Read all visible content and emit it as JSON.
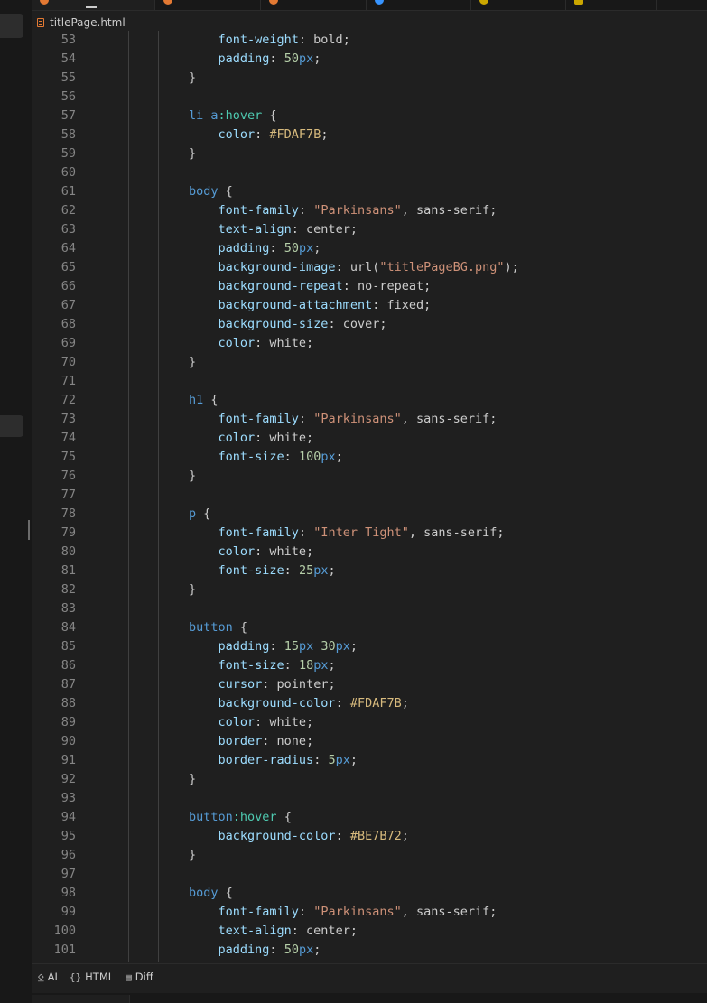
{
  "tab_icon_colors": [
    "#e37933",
    "#e37933",
    "#e37933",
    "#3794ff",
    "#cca700"
  ],
  "breadcrumb": {
    "file_name": "titlePage.html",
    "icon": "html-file-icon"
  },
  "code_lines": [
    {
      "n": "53",
      "t": [
        [
          "    ",
          "punc"
        ],
        [
          "font-weight",
          "prop"
        ],
        [
          ": bold;",
          "punc"
        ]
      ]
    },
    {
      "n": "54",
      "t": [
        [
          "    ",
          "punc"
        ],
        [
          "padding",
          "prop"
        ],
        [
          ": ",
          "punc"
        ],
        [
          "50",
          "num"
        ],
        [
          "px",
          "unit"
        ],
        [
          ";",
          "punc"
        ]
      ]
    },
    {
      "n": "55",
      "t": [
        [
          "}",
          "punc"
        ]
      ]
    },
    {
      "n": "56",
      "t": []
    },
    {
      "n": "57",
      "t": [
        [
          "li a",
          "sel"
        ],
        [
          ":hover",
          "pseudo"
        ],
        [
          " {",
          "punc"
        ]
      ]
    },
    {
      "n": "58",
      "t": [
        [
          "    ",
          "punc"
        ],
        [
          "color",
          "prop"
        ],
        [
          ": ",
          "punc"
        ],
        [
          "#FDAF7B",
          "hex"
        ],
        [
          ";",
          "punc"
        ]
      ]
    },
    {
      "n": "59",
      "t": [
        [
          "}",
          "punc"
        ]
      ]
    },
    {
      "n": "60",
      "t": []
    },
    {
      "n": "61",
      "t": [
        [
          "body",
          "sel"
        ],
        [
          " {",
          "punc"
        ]
      ]
    },
    {
      "n": "62",
      "t": [
        [
          "    ",
          "punc"
        ],
        [
          "font-family",
          "prop"
        ],
        [
          ": ",
          "punc"
        ],
        [
          "\"Parkinsans\"",
          "str"
        ],
        [
          ", sans-serif;",
          "punc"
        ]
      ]
    },
    {
      "n": "63",
      "t": [
        [
          "    ",
          "punc"
        ],
        [
          "text-align",
          "prop"
        ],
        [
          ": center;",
          "punc"
        ]
      ]
    },
    {
      "n": "64",
      "t": [
        [
          "    ",
          "punc"
        ],
        [
          "padding",
          "prop"
        ],
        [
          ": ",
          "punc"
        ],
        [
          "50",
          "num"
        ],
        [
          "px",
          "unit"
        ],
        [
          ";",
          "punc"
        ]
      ]
    },
    {
      "n": "65",
      "t": [
        [
          "    ",
          "punc"
        ],
        [
          "background-image",
          "prop"
        ],
        [
          ": url(",
          "punc"
        ],
        [
          "\"titlePageBG.png\"",
          "str"
        ],
        [
          ");",
          "punc"
        ]
      ]
    },
    {
      "n": "66",
      "t": [
        [
          "    ",
          "punc"
        ],
        [
          "background-repeat",
          "prop"
        ],
        [
          ": no-repeat;",
          "punc"
        ]
      ]
    },
    {
      "n": "67",
      "t": [
        [
          "    ",
          "punc"
        ],
        [
          "background-attachment",
          "prop"
        ],
        [
          ": fixed;",
          "punc"
        ]
      ]
    },
    {
      "n": "68",
      "t": [
        [
          "    ",
          "punc"
        ],
        [
          "background-size",
          "prop"
        ],
        [
          ": cover;",
          "punc"
        ]
      ]
    },
    {
      "n": "69",
      "t": [
        [
          "    ",
          "punc"
        ],
        [
          "color",
          "prop"
        ],
        [
          ": white;",
          "punc"
        ]
      ]
    },
    {
      "n": "70",
      "t": [
        [
          "}",
          "punc"
        ]
      ]
    },
    {
      "n": "71",
      "t": []
    },
    {
      "n": "72",
      "t": [
        [
          "h1",
          "sel"
        ],
        [
          " {",
          "punc"
        ]
      ]
    },
    {
      "n": "73",
      "t": [
        [
          "    ",
          "punc"
        ],
        [
          "font-family",
          "prop"
        ],
        [
          ": ",
          "punc"
        ],
        [
          "\"Parkinsans\"",
          "str"
        ],
        [
          ", sans-serif;",
          "punc"
        ]
      ]
    },
    {
      "n": "74",
      "t": [
        [
          "    ",
          "punc"
        ],
        [
          "color",
          "prop"
        ],
        [
          ": white;",
          "punc"
        ]
      ]
    },
    {
      "n": "75",
      "t": [
        [
          "    ",
          "punc"
        ],
        [
          "font-size",
          "prop"
        ],
        [
          ": ",
          "punc"
        ],
        [
          "100",
          "num"
        ],
        [
          "px",
          "unit"
        ],
        [
          ";",
          "punc"
        ]
      ]
    },
    {
      "n": "76",
      "t": [
        [
          "}",
          "punc"
        ]
      ]
    },
    {
      "n": "77",
      "t": []
    },
    {
      "n": "78",
      "t": [
        [
          "p",
          "sel"
        ],
        [
          " {",
          "punc"
        ]
      ]
    },
    {
      "n": "79",
      "t": [
        [
          "    ",
          "punc"
        ],
        [
          "font-family",
          "prop"
        ],
        [
          ": ",
          "punc"
        ],
        [
          "\"Inter Tight\"",
          "str"
        ],
        [
          ", sans-serif;",
          "punc"
        ]
      ]
    },
    {
      "n": "80",
      "t": [
        [
          "    ",
          "punc"
        ],
        [
          "color",
          "prop"
        ],
        [
          ": white;",
          "punc"
        ]
      ]
    },
    {
      "n": "81",
      "t": [
        [
          "    ",
          "punc"
        ],
        [
          "font-size",
          "prop"
        ],
        [
          ": ",
          "punc"
        ],
        [
          "25",
          "num"
        ],
        [
          "px",
          "unit"
        ],
        [
          ";",
          "punc"
        ]
      ]
    },
    {
      "n": "82",
      "t": [
        [
          "}",
          "punc"
        ]
      ]
    },
    {
      "n": "83",
      "t": []
    },
    {
      "n": "84",
      "t": [
        [
          "button",
          "sel"
        ],
        [
          " {",
          "punc"
        ]
      ]
    },
    {
      "n": "85",
      "t": [
        [
          "    ",
          "punc"
        ],
        [
          "padding",
          "prop"
        ],
        [
          ": ",
          "punc"
        ],
        [
          "15",
          "num"
        ],
        [
          "px",
          "unit"
        ],
        [
          " ",
          "punc"
        ],
        [
          "30",
          "num"
        ],
        [
          "px",
          "unit"
        ],
        [
          ";",
          "punc"
        ]
      ]
    },
    {
      "n": "86",
      "t": [
        [
          "    ",
          "punc"
        ],
        [
          "font-size",
          "prop"
        ],
        [
          ": ",
          "punc"
        ],
        [
          "18",
          "num"
        ],
        [
          "px",
          "unit"
        ],
        [
          ";",
          "punc"
        ]
      ]
    },
    {
      "n": "87",
      "t": [
        [
          "    ",
          "punc"
        ],
        [
          "cursor",
          "prop"
        ],
        [
          ": pointer;",
          "punc"
        ]
      ]
    },
    {
      "n": "88",
      "t": [
        [
          "    ",
          "punc"
        ],
        [
          "background-color",
          "prop"
        ],
        [
          ": ",
          "punc"
        ],
        [
          "#FDAF7B",
          "hex"
        ],
        [
          ";",
          "punc"
        ]
      ]
    },
    {
      "n": "89",
      "t": [
        [
          "    ",
          "punc"
        ],
        [
          "color",
          "prop"
        ],
        [
          ": white;",
          "punc"
        ]
      ]
    },
    {
      "n": "90",
      "t": [
        [
          "    ",
          "punc"
        ],
        [
          "border",
          "prop"
        ],
        [
          ": none;",
          "punc"
        ]
      ]
    },
    {
      "n": "91",
      "t": [
        [
          "    ",
          "punc"
        ],
        [
          "border-radius",
          "prop"
        ],
        [
          ": ",
          "punc"
        ],
        [
          "5",
          "num"
        ],
        [
          "px",
          "unit"
        ],
        [
          ";",
          "punc"
        ]
      ]
    },
    {
      "n": "92",
      "t": [
        [
          "}",
          "punc"
        ]
      ]
    },
    {
      "n": "93",
      "t": []
    },
    {
      "n": "94",
      "t": [
        [
          "button",
          "sel"
        ],
        [
          ":hover",
          "pseudo"
        ],
        [
          " {",
          "punc"
        ]
      ]
    },
    {
      "n": "95",
      "t": [
        [
          "    ",
          "punc"
        ],
        [
          "background-color",
          "prop"
        ],
        [
          ": ",
          "punc"
        ],
        [
          "#BE7B72",
          "hex"
        ],
        [
          ";",
          "punc"
        ]
      ]
    },
    {
      "n": "96",
      "t": [
        [
          "}",
          "punc"
        ]
      ]
    },
    {
      "n": "97",
      "t": []
    },
    {
      "n": "98",
      "t": [
        [
          "body",
          "sel"
        ],
        [
          " {",
          "punc"
        ]
      ]
    },
    {
      "n": "99",
      "t": [
        [
          "    ",
          "punc"
        ],
        [
          "font-family",
          "prop"
        ],
        [
          ": ",
          "punc"
        ],
        [
          "\"Parkinsans\"",
          "str"
        ],
        [
          ", sans-serif;",
          "punc"
        ]
      ]
    },
    {
      "n": "100",
      "t": [
        [
          "    ",
          "punc"
        ],
        [
          "text-align",
          "prop"
        ],
        [
          ": center;",
          "punc"
        ]
      ]
    },
    {
      "n": "101",
      "t": [
        [
          "    ",
          "punc"
        ],
        [
          "padding",
          "prop"
        ],
        [
          ": ",
          "punc"
        ],
        [
          "50",
          "num"
        ],
        [
          "px",
          "unit"
        ],
        [
          ";",
          "punc"
        ]
      ]
    }
  ],
  "status_tabs": [
    {
      "icon": "ai-icon",
      "glyph": "⍚",
      "label": "AI"
    },
    {
      "icon": "html-icon",
      "glyph": "{}",
      "label": "HTML"
    },
    {
      "icon": "diff-icon",
      "glyph": "▤",
      "label": "Diff"
    }
  ]
}
